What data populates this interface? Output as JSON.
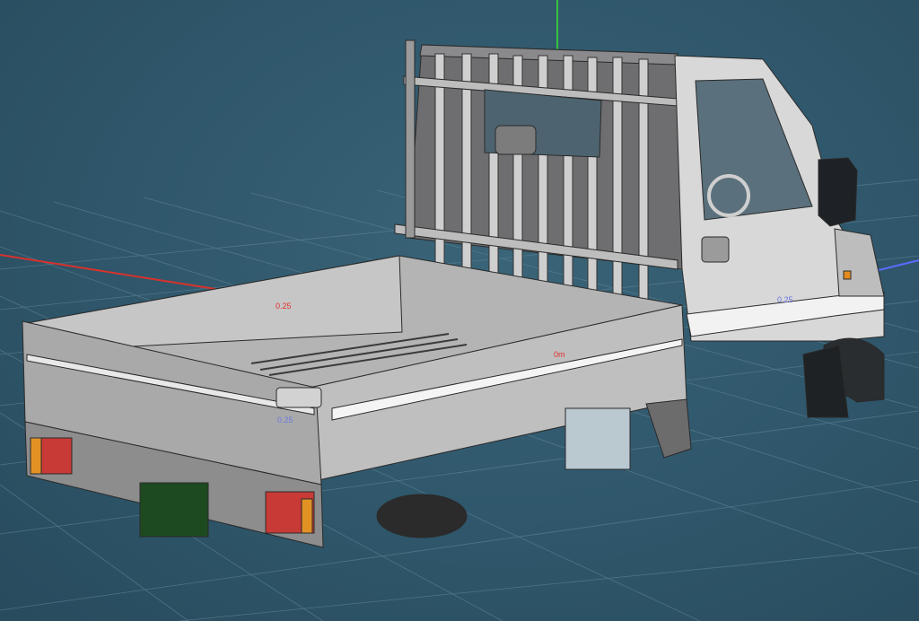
{
  "viewport": {
    "model": "kei-truck-wireframe",
    "background_color": "#2f566a",
    "grid_color": "#5c8294",
    "axis_colors": {
      "x": "#d8322c",
      "y": "#37c23a",
      "z": "#5a6cff"
    }
  },
  "measure_labels": [
    {
      "text": "0.25",
      "color": "red"
    },
    {
      "text": "0m",
      "color": "red"
    },
    {
      "text": "0.25",
      "color": "blue"
    },
    {
      "text": "0.25",
      "color": "blue"
    }
  ]
}
